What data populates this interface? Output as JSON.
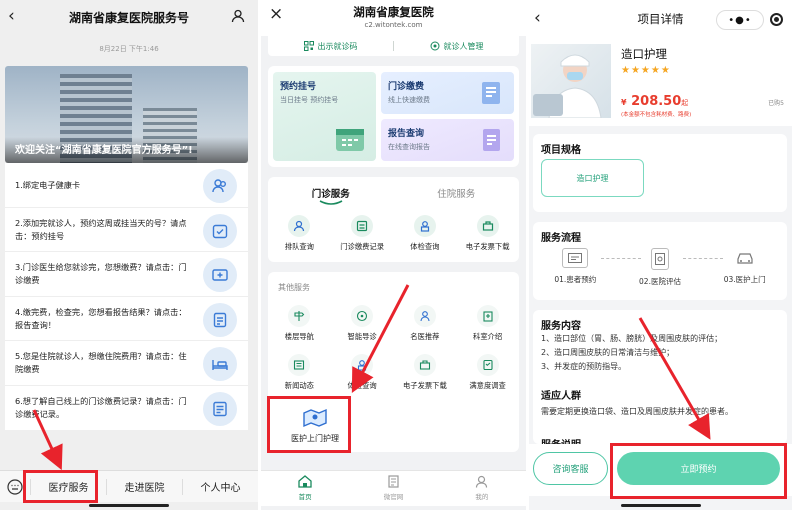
{
  "panel1": {
    "header_title": "湖南省康复医院服务号",
    "date": "8月22日 下午1:46",
    "banner_title": "欢迎关注“湖南省康复医院官方服务号”!",
    "items": [
      {
        "text": "1.绑定电子健康卡",
        "icon": "user-group-icon"
      },
      {
        "text": "2.添加完就诊人，预约这周或挂当天的号？请点击：预约挂号",
        "icon": "calendar-check-icon"
      },
      {
        "text": "3.门诊医生给您就诊完，您想缴费？请点击：门诊缴费",
        "icon": "card-plus-icon"
      },
      {
        "text": "4.缴完费，检查完，您想看报告结果？请点击：报告查询！",
        "icon": "report-icon"
      },
      {
        "text": "5.您是住院就诊人，想缴住院费用？请点击：住院缴费",
        "icon": "bed-icon"
      },
      {
        "text": "6.想了解自己线上的门诊缴费记录？请点击：门诊缴费记录。",
        "icon": "record-icon"
      }
    ],
    "tabbar": [
      "医疗服务",
      "走进医院",
      "个人中心"
    ]
  },
  "panel2": {
    "header_title": "湖南省康复医院",
    "header_url": "c2.witontek.com",
    "top_actions": [
      "出示就诊码",
      "就诊人管理"
    ],
    "boxes": [
      {
        "title": "预约挂号",
        "sub": "当日挂号 预约挂号"
      },
      {
        "title": "门诊缴费",
        "sub": "线上快速缴费"
      },
      {
        "title": "报告查询",
        "sub": "在线查询报告"
      }
    ],
    "tabs": [
      "门诊服务",
      "住院服务"
    ],
    "services": [
      "排队查询",
      "门诊缴费记录",
      "体检查询",
      "电子发票下载"
    ],
    "other_label": "其他服务",
    "other_row1": [
      "楼层导航",
      "智能导诊",
      "名医推荐",
      "科室介绍"
    ],
    "other_row2": [
      "新闻动态",
      "体检查询",
      "电子发票下载",
      "满意度调查"
    ],
    "home_care": "医护上门护理",
    "bottom_nav": [
      "首页",
      "微官网",
      "我的"
    ]
  },
  "panel3": {
    "header_title": "项目详情",
    "product_name": "造口护理",
    "stars": "★★★★★",
    "currency": "¥",
    "price": "208.50",
    "price_suffix": "起",
    "price_note": "(本金额不包含耗材费、路费)",
    "sold": "已购5",
    "spec_title": "项目规格",
    "spec_chip": "造口护理",
    "flow_title": "服务流程",
    "flow_steps": [
      "01.患者预约",
      "02.医院评估",
      "03.医护上门"
    ],
    "content_title": "服务内容",
    "content_lines": [
      "1、造口部位（胃、肠、膀胱）及周围皮肤的评估；",
      "2、造口周围皮肤的日常清洁与维护；",
      "3、并发症的预防指导。"
    ],
    "crowd_title": "适应人群",
    "crowd_text": "需要定期更换造口袋、造口及周围皮肤并发症的患者。",
    "more_title": "服务说明",
    "btn_service": "咨询客服",
    "btn_book": "立即预约"
  },
  "colors": {
    "green": "#1a8a5e",
    "mint": "#5ed3b0",
    "red": "#e8232c",
    "price": "#e83d2e"
  }
}
